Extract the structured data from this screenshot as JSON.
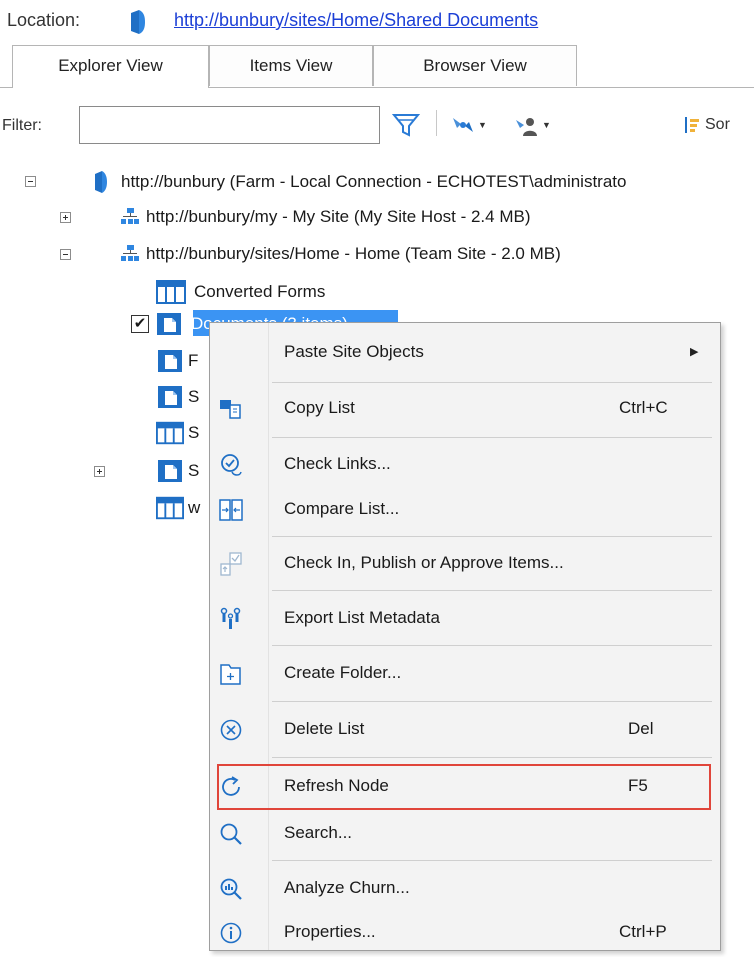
{
  "location": {
    "label": "Location:",
    "url": "http://bunbury/sites/Home/Shared Documents"
  },
  "tabs": [
    {
      "label": "Explorer View",
      "active": true
    },
    {
      "label": "Items View",
      "active": false
    },
    {
      "label": "Browser View",
      "active": false
    }
  ],
  "filter": {
    "label": "Filter:",
    "value": "",
    "sort_label": "Sor"
  },
  "tree": {
    "root": "http://bunbury (Farm - Local Connection - ECHOTEST\\administrato",
    "site_my": "http://bunbury/my - My Site (My Site Host - 2.4 MB)",
    "site_home": "http://bunbury/sites/Home - Home (Team Site - 2.0 MB)",
    "lists": [
      {
        "label": "Converted Forms",
        "type": "list"
      },
      {
        "label": "Documents (3 items)",
        "type": "library",
        "selected": true
      },
      {
        "label": "F",
        "type": "library"
      },
      {
        "label": "S",
        "type": "library"
      },
      {
        "label": "S",
        "type": "list"
      },
      {
        "label": "S",
        "type": "library"
      },
      {
        "label": "w",
        "type": "list"
      }
    ]
  },
  "context_menu": {
    "items": [
      {
        "label": "Paste Site Objects",
        "icon": "none",
        "shortcut": "",
        "submenu": true
      },
      {
        "label": "Copy List",
        "icon": "copy-list-icon",
        "shortcut": "Ctrl+C"
      },
      {
        "label": "Check Links...",
        "icon": "check-links-icon",
        "shortcut": ""
      },
      {
        "label": "Compare List...",
        "icon": "compare-icon",
        "shortcut": ""
      },
      {
        "label": "Check In, Publish or Approve Items...",
        "icon": "check-in-icon",
        "shortcut": ""
      },
      {
        "label": "Export List Metadata",
        "icon": "export-metadata-icon",
        "shortcut": ""
      },
      {
        "label": "Create Folder...",
        "icon": "create-folder-icon",
        "shortcut": ""
      },
      {
        "label": "Delete List",
        "icon": "delete-icon",
        "shortcut": "Del"
      },
      {
        "label": "Refresh Node",
        "icon": "refresh-icon",
        "shortcut": "F5",
        "highlighted": true
      },
      {
        "label": "Search...",
        "icon": "search-icon",
        "shortcut": ""
      },
      {
        "label": "Analyze Churn...",
        "icon": "analyze-churn-icon",
        "shortcut": ""
      },
      {
        "label": "Properties...",
        "icon": "properties-icon",
        "shortcut": "Ctrl+P"
      }
    ],
    "submenu_arrow": "▶"
  },
  "colors": {
    "link": "#1c3fd6",
    "selection": "#3b94f3",
    "highlight_border": "#e0453a",
    "icon_blue": "#1f6fc5"
  }
}
